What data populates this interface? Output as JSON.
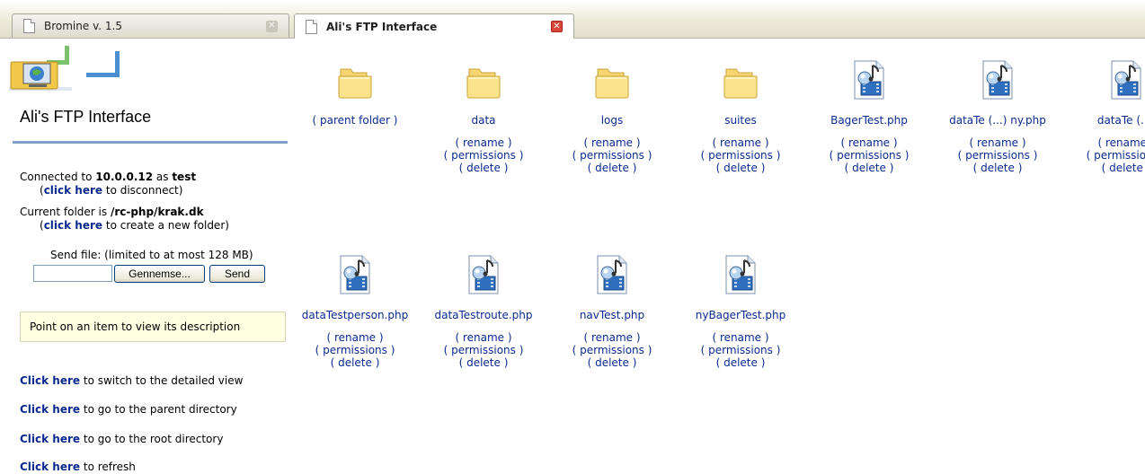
{
  "tabs": [
    {
      "title": "Bromine v. 1.5",
      "active": false
    },
    {
      "title": "Ali's FTP Interface",
      "active": true
    }
  ],
  "sidebar": {
    "title": "Ali's FTP Interface",
    "connection": {
      "prefix": "Connected to ",
      "host": "10.0.0.12",
      "as_text": " as ",
      "user": "test",
      "link": "click here",
      "link_suffix": " to disconnect)"
    },
    "folder": {
      "prefix": "Current folder is ",
      "path": "/rc-php/krak.dk",
      "link": "click here",
      "link_suffix": " to create a new folder)"
    },
    "send_label": "Send file: (limited to at most 128 MB)",
    "file_input_value": "",
    "browse_label": "Gennemse...",
    "send_button_label": "Send",
    "description": "Point on an item to view its description",
    "actions": [
      {
        "link": "Click here",
        "text": " to switch to the detailed view"
      },
      {
        "link": "Click here",
        "text": " to go to the parent directory"
      },
      {
        "link": "Click here",
        "text": " to go to the root directory"
      },
      {
        "link": "Click here",
        "text": " to refresh"
      }
    ]
  },
  "ops": {
    "rename": "( rename )",
    "permissions": "( permissions )",
    "delete": "( delete )"
  },
  "items": [
    {
      "name": "( parent folder )",
      "icon": "folder-icon",
      "ops": false
    },
    {
      "name": "data",
      "icon": "folder-icon",
      "ops": true
    },
    {
      "name": "logs",
      "icon": "folder-icon",
      "ops": true
    },
    {
      "name": "suites",
      "icon": "folder-icon",
      "ops": true
    },
    {
      "name": "BagerTest.php",
      "icon": "media-file-icon",
      "ops": true
    },
    {
      "name": "dataTe (...) ny.php",
      "icon": "media-file-icon",
      "ops": true
    },
    {
      "name": "dataTe (...)",
      "icon": "media-file-icon",
      "ops": true
    },
    {
      "name": "dataTestperson.php",
      "icon": "media-file-icon",
      "ops": true
    },
    {
      "name": "dataTestroute.php",
      "icon": "media-file-icon",
      "ops": true
    },
    {
      "name": "navTest.php",
      "icon": "media-file-icon",
      "ops": true
    },
    {
      "name": "nyBagerTest.php",
      "icon": "media-file-icon",
      "ops": true
    }
  ]
}
